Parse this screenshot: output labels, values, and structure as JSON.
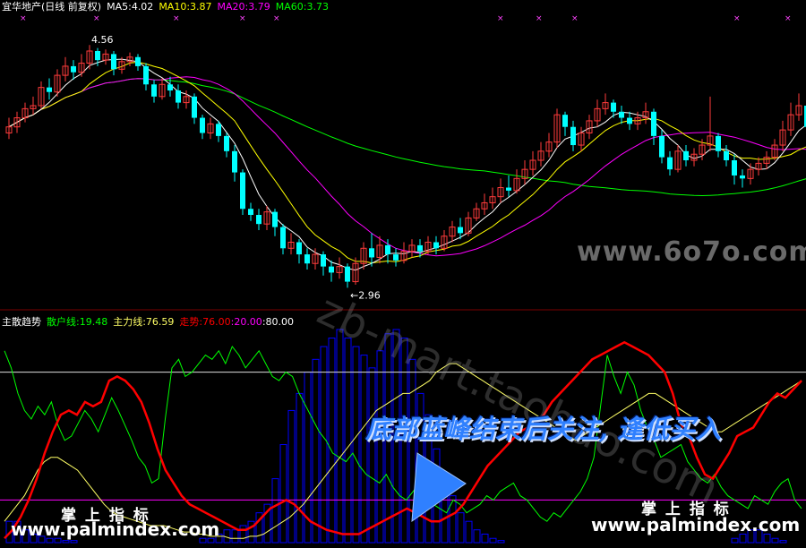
{
  "header_main": {
    "title": "宜华地产(日线 前复权)",
    "ma5": "MA5:4.02",
    "ma10": "MA10:3.87",
    "ma20": "MA20:3.79",
    "ma60": "MA60:3.73"
  },
  "header_sub": {
    "name": "主散趋势",
    "retail": "散户线:19.48",
    "main": "主力线:76.59",
    "trend": "走势:76.00",
    "l20": ":20.00",
    "l80": ":80.00"
  },
  "annotations": {
    "high": "4.56",
    "low": "←2.96",
    "banner": "底部蓝峰结束后关注, 逢低买入",
    "wm_site1": "www.6o7o.com",
    "wm_diag": "zb-mart.taobao.com",
    "wm_cn": "掌 上 指 标",
    "wm_site2": "www.palmindex.com"
  },
  "colors": {
    "up": "#ff3b3b",
    "down": "#00ffff",
    "ma5": "#ffffff",
    "ma10": "#ffff00",
    "ma20": "#ff00ff",
    "ma60": "#00ff00",
    "retail": "#00ff00",
    "main": "#ffff66",
    "trend": "#ff0000",
    "bars": "#0000ff",
    "banner": "#2f80ff"
  },
  "chart_data": [
    {
      "type": "candlestick",
      "title": "宜华地产(日线 前复权)",
      "ylim": [
        2.85,
        4.75
      ],
      "candles": [
        [
          3.98,
          4.02,
          4.08,
          3.94
        ],
        [
          4.02,
          4.08,
          4.12,
          3.98
        ],
        [
          4.08,
          4.14,
          4.18,
          4.05
        ],
        [
          4.14,
          4.16,
          4.22,
          4.1
        ],
        [
          4.16,
          4.28,
          4.32,
          4.14
        ],
        [
          4.28,
          4.25,
          4.34,
          4.2
        ],
        [
          4.25,
          4.36,
          4.4,
          4.22
        ],
        [
          4.36,
          4.42,
          4.48,
          4.32
        ],
        [
          4.42,
          4.38,
          4.46,
          4.33
        ],
        [
          4.38,
          4.44,
          4.5,
          4.35
        ],
        [
          4.44,
          4.52,
          4.56,
          4.4
        ],
        [
          4.52,
          4.46,
          4.54,
          4.42
        ],
        [
          4.46,
          4.5,
          4.53,
          4.43
        ],
        [
          4.5,
          4.4,
          4.52,
          4.36
        ],
        [
          4.4,
          4.45,
          4.48,
          4.37
        ],
        [
          4.45,
          4.48,
          4.51,
          4.42
        ],
        [
          4.48,
          4.42,
          4.5,
          4.39
        ],
        [
          4.42,
          4.3,
          4.44,
          4.26
        ],
        [
          4.3,
          4.22,
          4.33,
          4.18
        ],
        [
          4.22,
          4.3,
          4.34,
          4.2
        ],
        [
          4.3,
          4.26,
          4.35,
          4.22
        ],
        [
          4.26,
          4.18,
          4.3,
          4.14
        ],
        [
          4.18,
          4.22,
          4.26,
          4.14
        ],
        [
          4.22,
          4.08,
          4.24,
          4.04
        ],
        [
          4.08,
          3.98,
          4.1,
          3.94
        ],
        [
          3.98,
          4.04,
          4.08,
          3.94
        ],
        [
          4.04,
          3.96,
          4.06,
          3.92
        ],
        [
          3.96,
          3.86,
          3.98,
          3.82
        ],
        [
          3.86,
          3.72,
          3.9,
          3.66
        ],
        [
          3.72,
          3.48,
          3.74,
          3.44
        ],
        [
          3.48,
          3.44,
          3.52,
          3.4
        ],
        [
          3.44,
          3.38,
          3.48,
          3.34
        ],
        [
          3.38,
          3.46,
          3.5,
          3.34
        ],
        [
          3.46,
          3.36,
          3.48,
          3.3
        ],
        [
          3.36,
          3.22,
          3.38,
          3.18
        ],
        [
          3.22,
          3.26,
          3.32,
          3.18
        ],
        [
          3.26,
          3.18,
          3.28,
          3.12
        ],
        [
          3.18,
          3.12,
          3.22,
          3.08
        ],
        [
          3.12,
          3.18,
          3.22,
          3.08
        ],
        [
          3.18,
          3.1,
          3.2,
          3.04
        ],
        [
          3.1,
          3.06,
          3.14,
          3.0
        ],
        [
          3.06,
          3.1,
          3.16,
          3.02
        ],
        [
          3.1,
          3.0,
          3.12,
          2.96
        ],
        [
          3.0,
          3.12,
          3.16,
          2.98
        ],
        [
          3.12,
          3.22,
          3.26,
          3.08
        ],
        [
          3.22,
          3.16,
          3.32,
          3.1
        ],
        [
          3.16,
          3.24,
          3.3,
          3.12
        ],
        [
          3.24,
          3.18,
          3.28,
          3.12
        ],
        [
          3.18,
          3.14,
          3.22,
          3.1
        ],
        [
          3.14,
          3.2,
          3.26,
          3.12
        ],
        [
          3.2,
          3.24,
          3.28,
          3.16
        ],
        [
          3.24,
          3.2,
          3.28,
          3.16
        ],
        [
          3.2,
          3.26,
          3.3,
          3.18
        ],
        [
          3.26,
          3.22,
          3.3,
          3.18
        ],
        [
          3.22,
          3.3,
          3.34,
          3.2
        ],
        [
          3.3,
          3.36,
          3.4,
          3.26
        ],
        [
          3.36,
          3.32,
          3.42,
          3.28
        ],
        [
          3.32,
          3.42,
          3.46,
          3.3
        ],
        [
          3.42,
          3.48,
          3.52,
          3.4
        ],
        [
          3.48,
          3.52,
          3.58,
          3.44
        ],
        [
          3.52,
          3.56,
          3.62,
          3.48
        ],
        [
          3.56,
          3.62,
          3.68,
          3.52
        ],
        [
          3.62,
          3.6,
          3.7,
          3.56
        ],
        [
          3.6,
          3.68,
          3.74,
          3.58
        ],
        [
          3.68,
          3.74,
          3.8,
          3.64
        ],
        [
          3.74,
          3.8,
          3.86,
          3.7
        ],
        [
          3.8,
          3.86,
          3.92,
          3.76
        ],
        [
          3.86,
          3.92,
          3.98,
          3.82
        ],
        [
          3.92,
          4.1,
          4.14,
          3.88
        ],
        [
          4.1,
          4.02,
          4.12,
          3.96
        ],
        [
          4.02,
          3.9,
          4.06,
          3.86
        ],
        [
          3.9,
          3.98,
          4.02,
          3.86
        ],
        [
          3.98,
          4.06,
          4.1,
          3.94
        ],
        [
          4.06,
          4.14,
          4.2,
          4.02
        ],
        [
          4.14,
          4.18,
          4.24,
          4.1
        ],
        [
          4.18,
          4.12,
          4.2,
          4.08
        ],
        [
          4.12,
          4.08,
          4.16,
          4.04
        ],
        [
          4.08,
          4.04,
          4.12,
          4.0
        ],
        [
          4.04,
          4.08,
          4.12,
          4.0
        ],
        [
          4.08,
          4.12,
          4.18,
          4.04
        ],
        [
          4.12,
          3.96,
          4.14,
          3.9
        ],
        [
          3.96,
          3.82,
          4.0,
          3.78
        ],
        [
          3.82,
          3.74,
          3.86,
          3.7
        ],
        [
          3.74,
          3.86,
          3.9,
          3.72
        ],
        [
          3.86,
          3.8,
          3.9,
          3.76
        ],
        [
          3.8,
          3.84,
          3.88,
          3.76
        ],
        [
          3.84,
          3.9,
          3.94,
          3.8
        ],
        [
          3.9,
          3.96,
          4.22,
          3.86
        ],
        [
          3.96,
          3.86,
          3.98,
          3.82
        ],
        [
          3.86,
          3.8,
          3.9,
          3.76
        ],
        [
          3.8,
          3.7,
          3.84,
          3.64
        ],
        [
          3.7,
          3.68,
          3.74,
          3.62
        ],
        [
          3.68,
          3.74,
          3.78,
          3.64
        ],
        [
          3.74,
          3.78,
          3.82,
          3.7
        ],
        [
          3.78,
          3.82,
          3.86,
          3.74
        ],
        [
          3.82,
          3.9,
          3.94,
          3.8
        ],
        [
          3.9,
          4.0,
          4.06,
          3.86
        ],
        [
          4.0,
          4.1,
          4.18,
          3.96
        ],
        [
          4.1,
          4.16,
          4.24,
          4.06
        ],
        [
          4.16,
          4.02,
          4.18,
          3.98
        ]
      ]
    },
    {
      "type": "line+bar",
      "title": "主散趋势",
      "ylim": [
        0,
        100
      ],
      "hlines": [
        20,
        80
      ],
      "series": [
        {
          "name": "散户线",
          "values": [
            90,
            82,
            70,
            62,
            58,
            64,
            60,
            66,
            55,
            48,
            50,
            56,
            62,
            58,
            52,
            60,
            68,
            62,
            55,
            48,
            40,
            36,
            28,
            30,
            58,
            82,
            86,
            78,
            80,
            84,
            88,
            86,
            90,
            84,
            92,
            88,
            82,
            86,
            90,
            84,
            78,
            76,
            80,
            78,
            70,
            64,
            58,
            52,
            48,
            42,
            40,
            38,
            42,
            36,
            32,
            30,
            28,
            32,
            26,
            22,
            20,
            24,
            28,
            22,
            18,
            16,
            14,
            20,
            18,
            14,
            16,
            18,
            22,
            20,
            24,
            26,
            28,
            22,
            20,
            16,
            12,
            10,
            14,
            12,
            16,
            20,
            24,
            30,
            40,
            64,
            88,
            78,
            70,
            80,
            74,
            62,
            54,
            48,
            40,
            42,
            44,
            46,
            38,
            34,
            30,
            28,
            32,
            26,
            22,
            20,
            18,
            16,
            22,
            20,
            18,
            24,
            28,
            30,
            20,
            16
          ]
        },
        {
          "name": "主力线",
          "values": [
            10,
            14,
            18,
            22,
            28,
            34,
            38,
            40,
            40,
            38,
            36,
            34,
            30,
            26,
            22,
            18,
            15,
            13,
            12,
            11,
            10,
            9,
            8,
            8,
            8,
            7,
            6,
            5,
            5,
            4,
            4,
            3,
            3,
            3,
            2,
            2,
            2,
            3,
            3,
            4,
            6,
            8,
            10,
            12,
            15,
            18,
            22,
            26,
            30,
            34,
            38,
            42,
            46,
            50,
            54,
            58,
            62,
            64,
            66,
            68,
            70,
            70,
            72,
            74,
            76,
            80,
            82,
            84,
            84,
            82,
            80,
            78,
            76,
            74,
            72,
            70,
            68,
            66,
            64,
            62,
            60,
            58,
            56,
            54,
            52,
            50,
            48,
            50,
            52,
            54,
            56,
            58,
            60,
            62,
            64,
            66,
            68,
            70,
            70,
            68,
            66,
            64,
            62,
            60,
            58,
            56,
            54,
            52,
            52,
            54,
            56,
            58,
            60,
            62,
            64,
            66,
            68,
            70,
            72,
            74,
            76
          ]
        },
        {
          "name": "走势",
          "values": [
            2,
            6,
            12,
            20,
            30,
            42,
            52,
            60,
            62,
            60,
            66,
            64,
            66,
            76,
            78,
            76,
            72,
            66,
            56,
            44,
            34,
            28,
            22,
            18,
            16,
            14,
            12,
            10,
            8,
            6,
            6,
            8,
            12,
            16,
            18,
            20,
            18,
            14,
            10,
            8,
            6,
            5,
            4,
            4,
            4,
            6,
            8,
            10,
            12,
            14,
            16,
            14,
            12,
            10,
            10,
            12,
            14,
            18,
            24,
            30,
            36,
            40,
            44,
            48,
            52,
            54,
            56,
            60,
            66,
            70,
            74,
            78,
            82,
            86,
            88,
            90,
            92,
            94,
            92,
            90,
            88,
            84,
            80,
            70,
            56,
            50,
            40,
            32,
            30,
            36,
            42,
            50,
            52,
            54,
            60,
            66,
            70,
            68,
            72,
            76
          ]
        },
        {
          "name": "bars",
          "values": [
            10,
            10,
            6,
            4,
            3,
            2,
            2,
            1,
            1,
            0,
            0,
            0,
            0,
            0,
            0,
            0,
            0,
            0,
            0,
            0,
            0,
            0,
            0,
            0,
            2,
            2,
            4,
            6,
            6,
            8,
            10,
            14,
            18,
            30,
            46,
            62,
            70,
            80,
            86,
            92,
            96,
            100,
            96,
            92,
            88,
            82,
            90,
            98,
            100,
            96,
            86,
            70,
            60,
            44,
            30,
            22,
            14,
            10,
            6,
            4,
            2,
            1,
            0,
            0,
            0,
            0,
            0,
            0,
            0,
            0,
            0,
            0,
            0,
            0,
            0,
            0,
            0,
            0,
            0,
            0,
            0,
            0,
            0,
            0,
            0,
            0,
            0,
            0,
            0,
            0,
            2,
            4,
            6,
            6,
            4,
            2,
            1,
            0,
            0,
            0
          ]
        }
      ]
    }
  ]
}
